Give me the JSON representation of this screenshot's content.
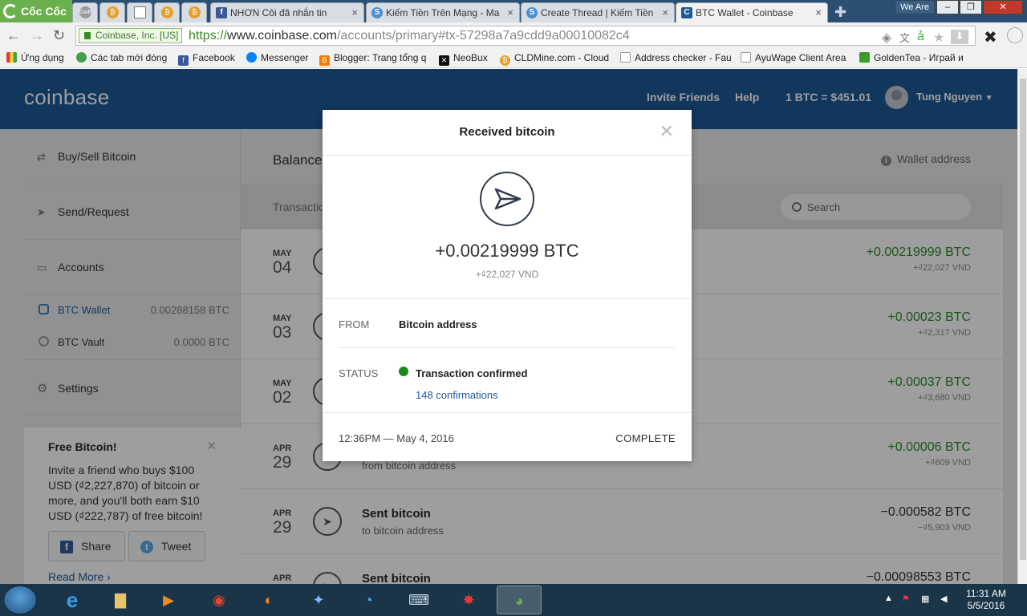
{
  "browser": {
    "logo_text": "Cốc Cốc",
    "tabs": [
      {
        "title": "NHƠN Côi đã nhắn tin",
        "favicon": "facebook-icon"
      },
      {
        "title": "Kiếm Tiền Trên Mạng - Ma",
        "favicon": "s-site-icon"
      },
      {
        "title": "Create Thread | Kiếm Tiền",
        "favicon": "s-site-icon"
      },
      {
        "title": "BTC Wallet - Coinbase",
        "favicon": "coinbase-icon"
      }
    ],
    "window_label": "We Are",
    "security_label": "Coinbase, Inc. [US]",
    "url_scheme": "https://",
    "url_host": "www.coinbase.com",
    "url_path": "/accounts/primary#tx-57298a7a9cdd9a00010082c4",
    "bookmarks": [
      "Ứng dụng",
      "Các tab mới đóng",
      "Facebook",
      "Messenger",
      "Blogger: Trang tổng q",
      "NeoBux",
      "CLDMine.com - Cloud",
      "Address checker - Fau",
      "AyuWage Client Area",
      "GoldenTea - Играй и"
    ]
  },
  "header": {
    "brand": "coinbase",
    "invite": "Invite Friends",
    "help": "Help",
    "rate": "1 BTC = $451.01",
    "user": "Tung Nguyen"
  },
  "sidebar": {
    "buy_sell": "Buy/Sell Bitcoin",
    "send_request": "Send/Request",
    "accounts": "Accounts",
    "wallets": [
      {
        "name": "BTC Wallet",
        "balance": "0.00288158 BTC"
      },
      {
        "name": "BTC Vault",
        "balance": "0.0000 BTC"
      }
    ],
    "settings": "Settings",
    "promo": {
      "title": "Free Bitcoin!",
      "text": "Invite a friend who buys $100 USD (₫2,227,870) of bitcoin or more, and you'll both earn $10 USD (₫222,787) of free bitcoin!",
      "share": "Share",
      "tweet": "Tweet",
      "read_more": "Read More ›"
    }
  },
  "main": {
    "balance_label": "Balance",
    "wallet_address": "Wallet address",
    "transactions_label": "Transactions",
    "search_placeholder": "Search",
    "transactions": [
      {
        "month": "MAY",
        "day": "04",
        "title": "",
        "subtitle": "",
        "amount": "+0.00219999 BTC",
        "fiat": "+₫22,027 VND",
        "direction": "received"
      },
      {
        "month": "MAY",
        "day": "03",
        "title": "",
        "subtitle": "",
        "amount": "+0.00023 BTC",
        "fiat": "+₫2,317 VND",
        "direction": "received"
      },
      {
        "month": "MAY",
        "day": "02",
        "title": "",
        "subtitle": "",
        "amount": "+0.00037 BTC",
        "fiat": "+₫3,680 VND",
        "direction": "received"
      },
      {
        "month": "APR",
        "day": "29",
        "title": "",
        "subtitle": "from bitcoin address",
        "amount": "+0.00006 BTC",
        "fiat": "+₫609 VND",
        "direction": "received"
      },
      {
        "month": "APR",
        "day": "29",
        "title": "Sent bitcoin",
        "subtitle": "to bitcoin address",
        "amount": "−0.000582 BTC",
        "fiat": "−₫5,903 VND",
        "direction": "sent"
      },
      {
        "month": "APR",
        "day": "",
        "title": "Sent bitcoin",
        "subtitle": "",
        "amount": "−0.00098553 BTC",
        "fiat": "",
        "direction": "sent"
      }
    ]
  },
  "modal": {
    "title": "Received bitcoin",
    "amount": "+0.00219999 BTC",
    "fiat": "+₫22,027 VND",
    "from_label": "FROM",
    "from_value": "Bitcoin address",
    "status_label": "STATUS",
    "status_value": "Transaction confirmed",
    "confirmations": "148 confirmations",
    "timestamp": "12:36PM — May 4, 2016",
    "state": "COMPLETE",
    "status_color": "#1a8a1a"
  },
  "taskbar": {
    "time": "11:31 AM",
    "date": "5/5/2016"
  }
}
